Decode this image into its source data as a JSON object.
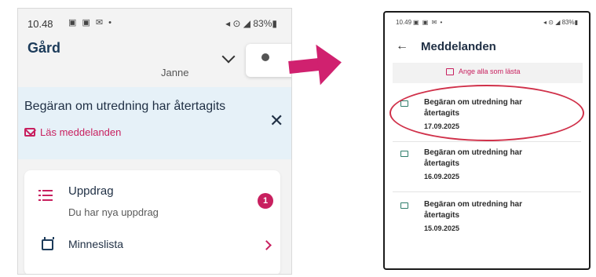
{
  "left": {
    "status_time": "10.48",
    "status_icons_left": "▣ ▣ ✉ •",
    "status_battery": "83%",
    "status_icons_right": "◂ ⊙ ◢ 83%▮",
    "title": "Gård",
    "user_name": "Janne",
    "banner_title": "Begäran om utredning har återtagits",
    "banner_link": "Läs meddelanden",
    "banner_close": "✕",
    "row1_title": "Uppdrag",
    "row1_subtitle": "Du har nya uppdrag",
    "row1_badge": "1",
    "row2_title": "Minneslista"
  },
  "right": {
    "status_time": "10.49",
    "status_icons_left": "▣ ▣ ✉ •",
    "status_icons_right": "◂ ⊙ ◢ 83%▮",
    "back": "←",
    "title": "Meddelanden",
    "mark_all": "Ange alla som lästa",
    "messages": [
      {
        "title": "Begäran om utredning har återtagits",
        "date": "17.09.2025"
      },
      {
        "title": "Begäran om utredning har återtagits",
        "date": "16.09.2025"
      },
      {
        "title": "Begäran om utredning har återtagits",
        "date": "15.09.2025"
      }
    ]
  },
  "colors": {
    "accent": "#c8205f",
    "arrow": "#d0216f",
    "highlight": "#d0314a",
    "banner_bg": "#e6f1f8",
    "navy": "#1c3b5a"
  }
}
